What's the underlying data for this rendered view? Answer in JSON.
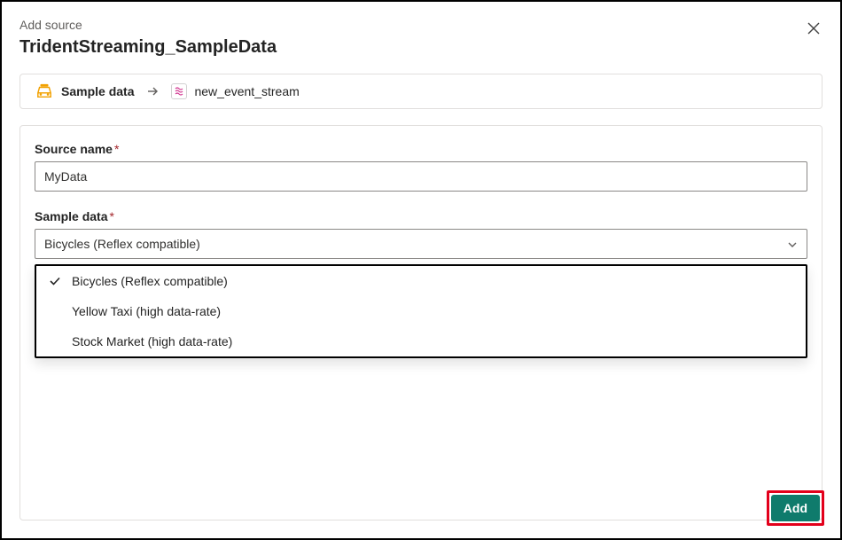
{
  "header": {
    "subtitle": "Add source",
    "title": "TridentStreaming_SampleData"
  },
  "breadcrumb": {
    "source_label": "Sample data",
    "target_label": "new_event_stream"
  },
  "form": {
    "source_name": {
      "label": "Source name",
      "value": "MyData"
    },
    "sample_data": {
      "label": "Sample data",
      "selected": "Bicycles (Reflex compatible)",
      "options": [
        "Bicycles (Reflex compatible)",
        "Yellow Taxi (high data-rate)",
        "Stock Market (high data-rate)"
      ]
    }
  },
  "footer": {
    "add_label": "Add"
  }
}
